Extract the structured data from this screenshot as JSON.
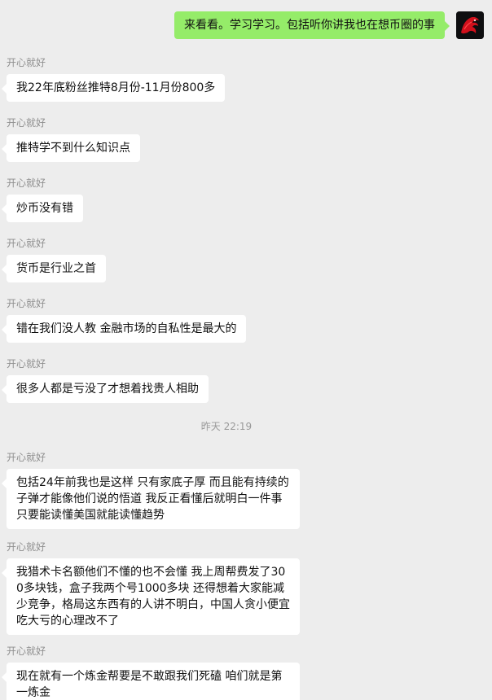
{
  "outgoing": {
    "text": "来看看。学习学习。包括听你讲我也在想币圈的事"
  },
  "sender_name": "开心就好",
  "timestamp": "昨天 22:19",
  "messages": [
    {
      "sender": "开心就好",
      "text": "我22年底粉丝推特8月份-11月份800多"
    },
    {
      "sender": "开心就好",
      "text": "推特学不到什么知识点"
    },
    {
      "sender": "开心就好",
      "text": "炒币没有错"
    },
    {
      "sender": "开心就好",
      "text": "货币是行业之首"
    },
    {
      "sender": "开心就好",
      "text": "错在我们没人教 金融市场的自私性是最大的"
    },
    {
      "sender": "开心就好",
      "text": "很多人都是亏没了才想着找贵人相助"
    },
    {
      "sender": "开心就好",
      "text": "包括24年前我也是这样 只有家底子厚 而且能有持续的子弹才能像他们说的悟道 我反正看懂后就明白一件事 只要能读懂美国就能读懂趋势"
    },
    {
      "sender": "开心就好",
      "text": "我猎术卡名额他们不懂的也不会懂 我上周帮费发了300多块钱，盒子我两个号1000多块 还得想着大家能减少竞争，格局这东西有的人讲不明白，中国人贪小便宜吃大亏的心理改不了"
    },
    {
      "sender": "开心就好",
      "text": "现在就有一个炼金帮要是不敢跟我们死磕 咱们就是第一炼金"
    }
  ]
}
